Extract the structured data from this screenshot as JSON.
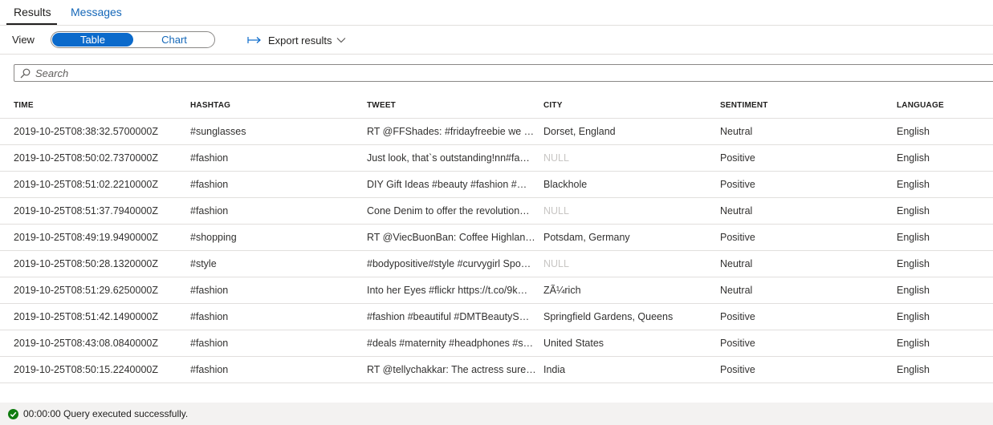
{
  "tabs": {
    "results": "Results",
    "messages": "Messages"
  },
  "toolbar": {
    "view_label": "View",
    "toggle_table": "Table",
    "toggle_chart": "Chart",
    "export_label": "Export results"
  },
  "search": {
    "placeholder": "Search",
    "value": ""
  },
  "table": {
    "columns": [
      "TIME",
      "HASHTAG",
      "TWEET",
      "CITY",
      "SENTIMENT",
      "LANGUAGE"
    ],
    "rows": [
      [
        "2019-10-25T08:38:32.5700000Z",
        "#sunglasses",
        "RT @FFShades: #fridayfreebie we a…",
        "Dorset, England",
        "Neutral",
        "English"
      ],
      [
        "2019-10-25T08:50:02.7370000Z",
        "#fashion",
        "Just look, that`s outstanding!nn#fa…",
        "NULL",
        "Positive",
        "English"
      ],
      [
        "2019-10-25T08:51:02.2210000Z",
        "#fashion",
        "DIY Gift Ideas #beauty #fashion #…",
        "Blackhole",
        "Positive",
        "English"
      ],
      [
        "2019-10-25T08:51:37.7940000Z",
        "#fashion",
        "Cone Denim to offer the revolution…",
        "NULL",
        "Neutral",
        "English"
      ],
      [
        "2019-10-25T08:49:19.9490000Z",
        "#shopping",
        "RT @ViecBuonBan: Coffee Highlan…",
        "Potsdam, Germany",
        "Positive",
        "English"
      ],
      [
        "2019-10-25T08:50:28.1320000Z",
        "#style",
        "#bodypositive#style #curvygirl Spo…",
        "NULL",
        "Neutral",
        "English"
      ],
      [
        "2019-10-25T08:51:29.6250000Z",
        "#fashion",
        "Into her Eyes #flickr https://t.co/9k…",
        "ZÃ¼rich",
        "Neutral",
        "English"
      ],
      [
        "2019-10-25T08:51:42.1490000Z",
        "#fashion",
        "#fashion #beautiful #DMTBeautyS…",
        "Springfield Gardens, Queens",
        "Positive",
        "English"
      ],
      [
        "2019-10-25T08:43:08.0840000Z",
        "#fashion",
        "#deals #maternity #headphones #s…",
        "United States",
        "Positive",
        "English"
      ],
      [
        "2019-10-25T08:50:15.2240000Z",
        "#fashion",
        "RT @tellychakkar: The actress surel…",
        "India",
        "Positive",
        "English"
      ]
    ]
  },
  "status": {
    "text": "00:00:00 Query executed successfully.",
    "icon": "check-circle-icon",
    "color": "#107c10"
  },
  "colors": {
    "accent": "#0b6acb",
    "link": "#1467b8",
    "null_text": "#c8c6c4"
  }
}
